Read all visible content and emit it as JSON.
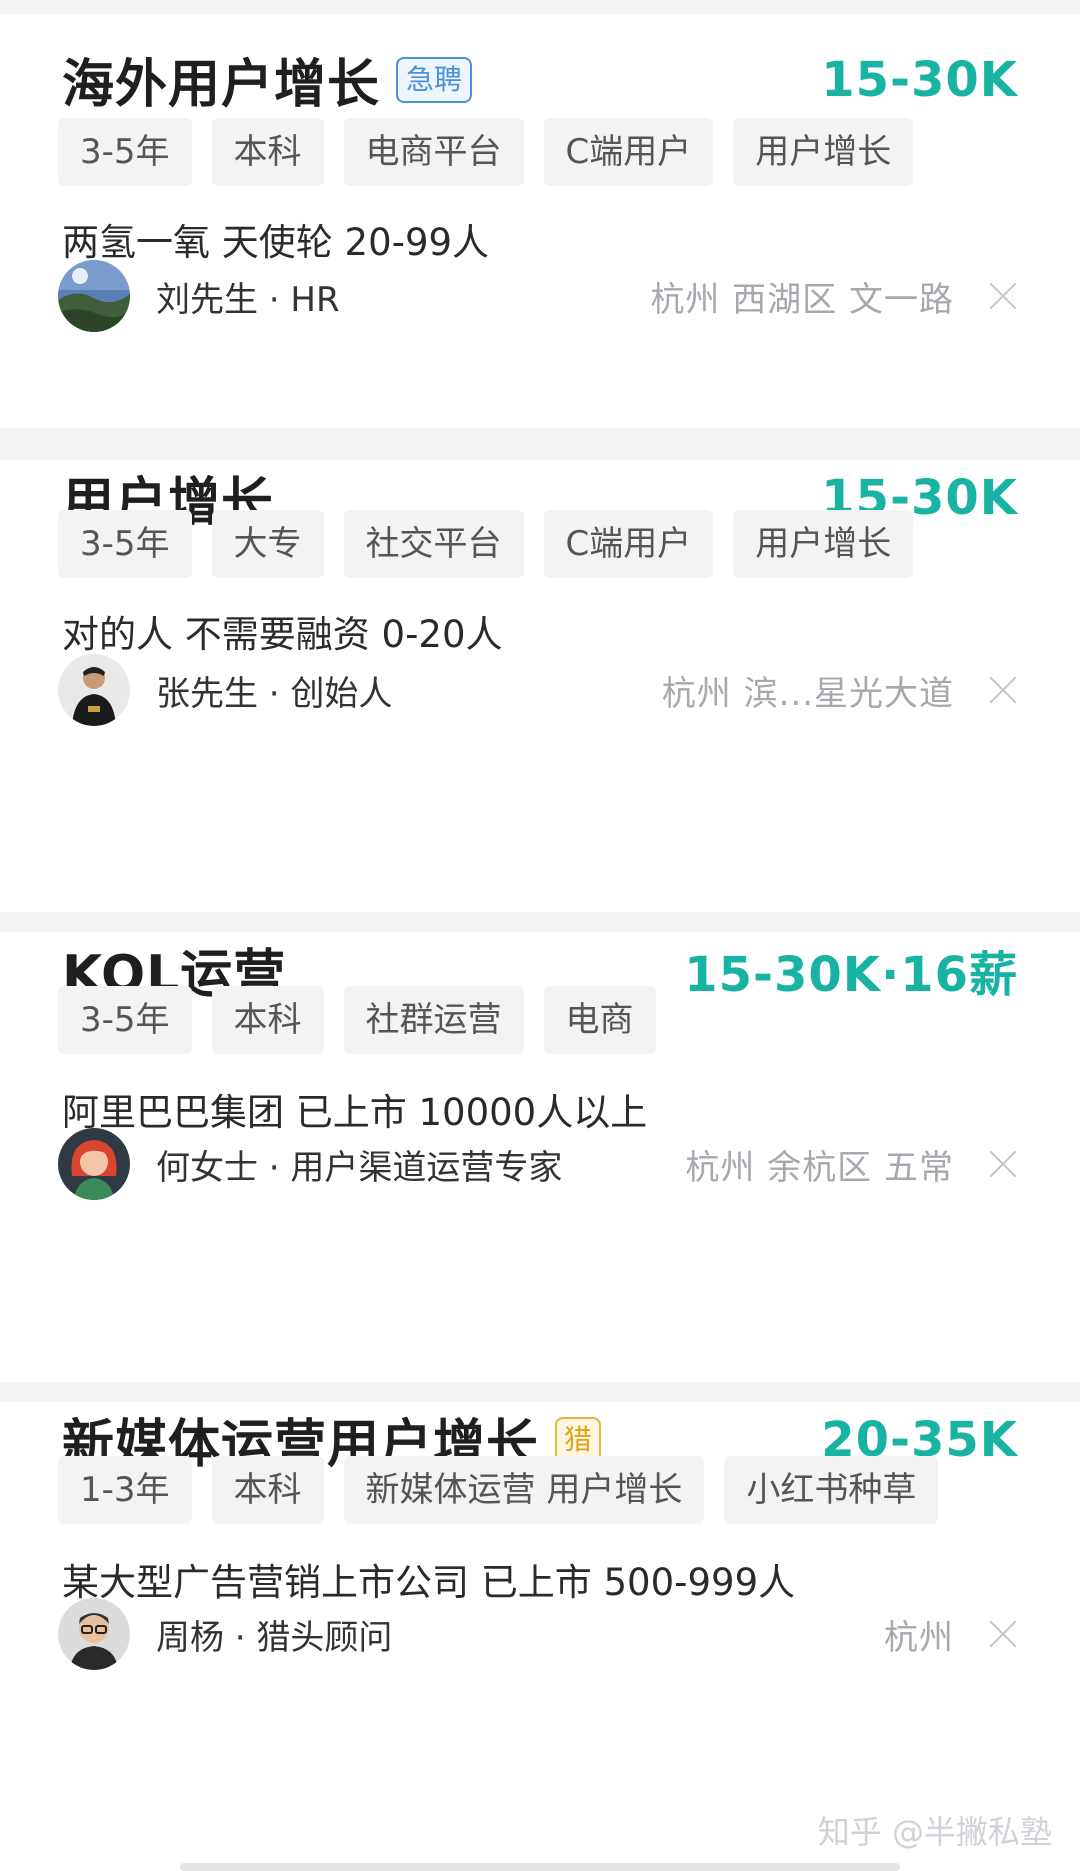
{
  "jobs": [
    {
      "title": "海外用户增长",
      "badge": "急聘",
      "salary": "15-30K",
      "tags": [
        "3-5年",
        "本科",
        "电商平台",
        "C端用户",
        "用户增长"
      ],
      "company": "两氢一氧  天使轮  20-99人",
      "person": "刘先生 · HR",
      "avatar": "landscape-avatar",
      "location": "杭州  西湖区  文一路"
    },
    {
      "title": "用户增长",
      "salary": "15-30K",
      "tags": [
        "3-5年",
        "大专",
        "社交平台",
        "C端用户",
        "用户增长"
      ],
      "company": "对的人  不需要融资  0-20人",
      "person": "张先生 · 创始人",
      "avatar": "man-black-shirt-avatar",
      "location": "杭州  滨...星光大道"
    },
    {
      "title": "KOL运营",
      "salary": "15-30K·16薪",
      "tags": [
        "3-5年",
        "本科",
        "社群运营",
        "电商"
      ],
      "company": "阿里巴巴集团  已上市  10000人以上",
      "person": "何女士 · 用户渠道运营专家",
      "avatar": "red-hair-woman-avatar",
      "location": "杭州  余杭区  五常"
    },
    {
      "title": "新媒体运营用户增长",
      "badge": "猎",
      "salary": "20-35K",
      "tags": [
        "1-3年",
        "本科",
        "新媒体运营 用户增长",
        "小红书种草"
      ],
      "company": "某大型广告营销上市公司  已上市  500-999人",
      "person": "周杨 · 猎头顾问",
      "avatar": "man-glasses-avatar",
      "location": "杭州"
    }
  ],
  "watermark": "知乎 @半撇私塾",
  "colors": {
    "salary": "#19b3a3",
    "urgent": "#4a90d9",
    "hunter": "#e0a318"
  }
}
